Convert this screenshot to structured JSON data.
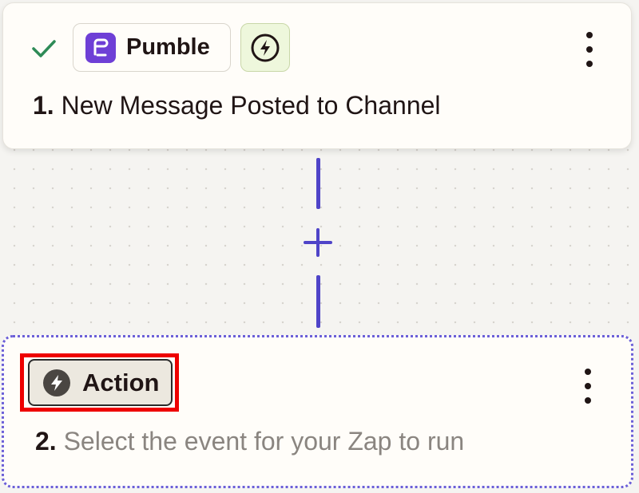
{
  "steps": [
    {
      "app_name": "Pumble",
      "app_icon": "pumble-logo-icon",
      "status_icon": "check-icon",
      "type_icon": "trigger-bolt-icon",
      "number": "1.",
      "title": "New Message Posted to Channel",
      "menu_icon": "more-vertical-icon"
    },
    {
      "chip_label": "Action",
      "chip_icon": "bolt-icon",
      "number": "2.",
      "title": "Select the event for your Zap to run",
      "menu_icon": "more-vertical-icon"
    }
  ],
  "connector": {
    "add_icon": "plus-icon"
  },
  "colors": {
    "brand_purple": "#6e3fd6",
    "connector": "#4f44c8",
    "check_green": "#2e8b57",
    "highlight_red": "#ee0000",
    "trigger_chip_bg": "#eef7dc"
  }
}
